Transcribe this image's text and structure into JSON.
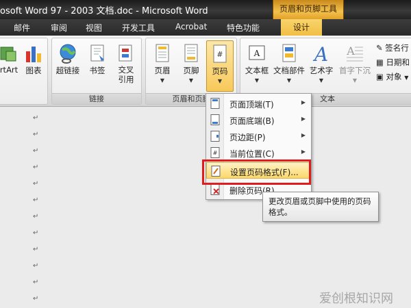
{
  "window": {
    "title": "osoft Word 97 - 2003 文档.doc - Microsoft Word",
    "context_tab_header": "页眉和页脚工具"
  },
  "tabs": [
    {
      "label": "邮件"
    },
    {
      "label": "审阅"
    },
    {
      "label": "视图"
    },
    {
      "label": "开发工具"
    },
    {
      "label": "Acrobat"
    },
    {
      "label": "特色功能"
    },
    {
      "label": "设计"
    }
  ],
  "ribbon": {
    "illustration_group": {
      "smartart": "rtArt",
      "chart": "图表"
    },
    "links_group": {
      "label": "链接",
      "hyperlink": "超链接",
      "bookmark": "书签",
      "crossref": "交叉\n引用"
    },
    "header_footer_group": {
      "label": "页眉和页脚",
      "header": "页眉",
      "footer": "页脚",
      "page_number": "页码"
    },
    "text_group": {
      "label": "文本",
      "textbox": "文本框",
      "quickparts": "文档部件",
      "wordart": "艺术字",
      "dropcap": "首字下沉",
      "signature": "签名行",
      "datetime": "日期和",
      "object": "对象"
    }
  },
  "menu": {
    "items": [
      {
        "label": "页面顶端(T)",
        "submenu": true
      },
      {
        "label": "页面底端(B)",
        "submenu": true
      },
      {
        "label": "页边距(P)",
        "submenu": true
      },
      {
        "label": "当前位置(C)",
        "submenu": true
      },
      {
        "label": "设置页码格式(F)...",
        "submenu": false,
        "highlighted": true
      },
      {
        "label": "删除页码(R)",
        "submenu": false
      }
    ]
  },
  "tooltip": {
    "text": "更改页眉或页脚中使用的页码格式。"
  },
  "document": {
    "paragraph_mark": "↵"
  },
  "watermark": "爱创根知识网",
  "colors": {
    "highlight": "#f8c95b",
    "annotation_red": "#e11c1c",
    "context_tab": "#f1bf44"
  }
}
